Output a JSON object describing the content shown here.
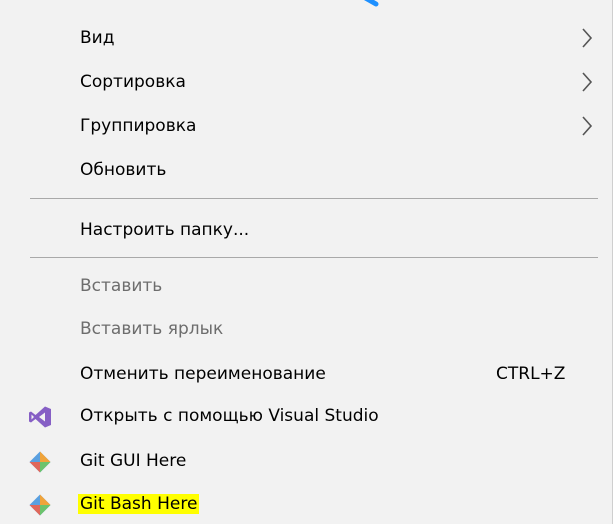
{
  "menu": {
    "items": [
      {
        "label": "Вид",
        "submenu": true
      },
      {
        "label": "Сортировка",
        "submenu": true
      },
      {
        "label": "Группировка",
        "submenu": true
      },
      {
        "label": "Обновить"
      },
      {
        "label": "Настроить папку..."
      },
      {
        "label": "Вставить",
        "disabled": true
      },
      {
        "label": "Вставить ярлык",
        "disabled": true
      },
      {
        "label": "Отменить переименование",
        "shortcut": "CTRL+Z"
      },
      {
        "label": "Открыть с помощью Visual Studio",
        "icon": "visual-studio-icon"
      },
      {
        "label": "Git GUI Here",
        "icon": "git-gui-icon"
      },
      {
        "label": "Git Bash Here",
        "icon": "git-bash-icon",
        "highlighted": true
      }
    ]
  },
  "colors": {
    "background": "#f2f2f2",
    "separator": "#a9a9a9",
    "disabled_text": "#6d6d6d",
    "highlight": "#ffff00",
    "vs_purple": "#865fc5",
    "top_hint": "#1e90ff"
  }
}
